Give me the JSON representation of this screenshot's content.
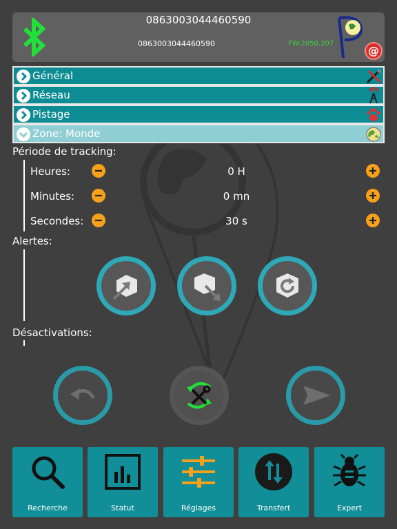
{
  "header": {
    "device_id": "0863003044460590",
    "device_id_small": "0863003044460590",
    "firmware": "FW:2050.207",
    "bluetooth_icon": "bluetooth-icon",
    "logo_icon": "globe-logo-icon",
    "email_icon": "at-sign-icon",
    "colors": {
      "bluetooth": "#22e03a",
      "firmware": "#3dd63d",
      "panel": "#606060"
    }
  },
  "sections": [
    {
      "label": "Général",
      "icon": "tools-icon",
      "expanded": false
    },
    {
      "label": "Réseau",
      "icon": "antenna-icon",
      "expanded": false
    },
    {
      "label": "Pistage",
      "icon": "paw-icon",
      "expanded": false
    },
    {
      "label": "Zone: Monde",
      "icon": "globe-icon",
      "expanded": true
    }
  ],
  "tracking": {
    "title": "Période de tracking:",
    "rows": [
      {
        "label": "Heures:",
        "value": "0 H"
      },
      {
        "label": "Minutes:",
        "value": "0 mn"
      },
      {
        "label": "Secondes:",
        "value": "30 s"
      }
    ]
  },
  "alerts": {
    "title": "Alertes:",
    "buttons": [
      "zone-enter-icon",
      "zone-exit-icon",
      "zone-refresh-icon"
    ]
  },
  "deactivations": {
    "title": "Désactivations:"
  },
  "actions": [
    "undo-icon",
    "tools-sync-icon",
    "send-icon"
  ],
  "tabbar": [
    {
      "label": "Recherche",
      "icon": "search-icon"
    },
    {
      "label": "Statut",
      "icon": "bar-chart-icon"
    },
    {
      "label": "Réglages",
      "icon": "sliders-icon"
    },
    {
      "label": "Transfert",
      "icon": "transfer-icon"
    },
    {
      "label": "Expert",
      "icon": "bug-icon"
    }
  ],
  "colors": {
    "accent": "#118e97",
    "ring": "#2fa8b8",
    "stepper": "#f7a11b",
    "background": "#3f3f3f"
  }
}
